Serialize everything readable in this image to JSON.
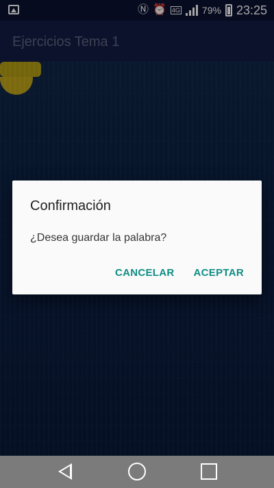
{
  "status_bar": {
    "left_icon": "image-icon",
    "icons": [
      "nfc-icon",
      "alarm-clock-icon",
      "network-4g-icon",
      "signal-bars-icon",
      "battery-icon"
    ],
    "network_label": "4G",
    "battery_percent": "79%",
    "battery_level": 0.79,
    "time": "23:25"
  },
  "app_bar": {
    "title": "Ejercicios Tema 1"
  },
  "dialog": {
    "title": "Confirmación",
    "message": "¿Desea guardar la palabra?",
    "buttons": {
      "cancel": "CANCELAR",
      "accept": "ACEPTAR"
    },
    "accent_color": "#0f8d84"
  },
  "nav_bar": {
    "icons": [
      "back-triangle-icon",
      "home-circle-icon",
      "recent-apps-square-icon"
    ]
  }
}
